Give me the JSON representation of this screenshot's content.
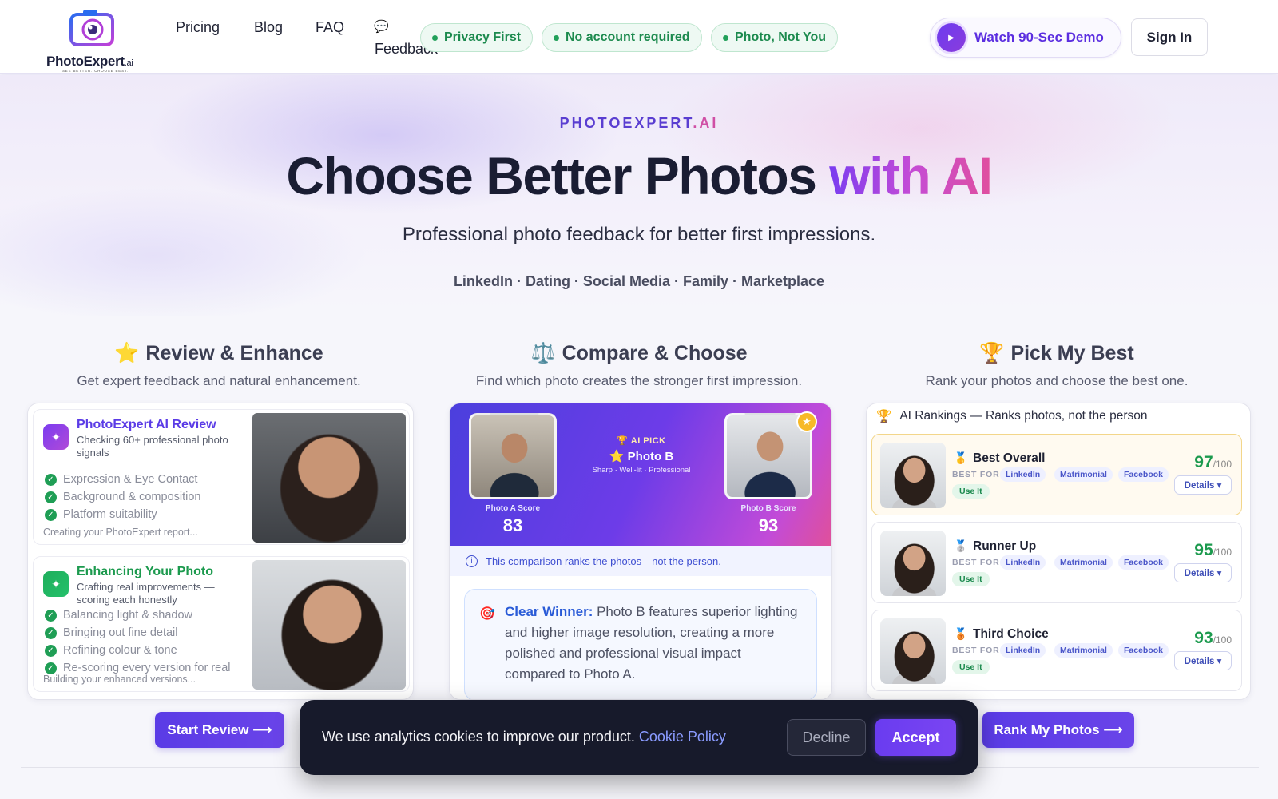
{
  "header": {
    "logo": {
      "brand": "PhotoExpert",
      "brand_suffix": ".ai",
      "tagline": "SEE BETTER. CHOOSE BEST."
    },
    "nav": [
      "Pricing",
      "Blog",
      "FAQ"
    ],
    "feedback_label": "Feedback",
    "pills": [
      "Privacy First",
      "No account required",
      "Photo, Not You"
    ],
    "demo_label": "Watch 90-Sec Demo",
    "signin_label": "Sign In"
  },
  "hero": {
    "eyebrow_main": "PHOTOEXPERT",
    "eyebrow_suffix": ".AI",
    "title_main": "Choose Better Photos ",
    "title_highlight": "with AI",
    "subtitle": "Professional photo feedback for better first impressions.",
    "categories": "LinkedIn · Dating · Social Media · Family · Marketplace"
  },
  "columns": [
    {
      "emoji": "⭐",
      "title": "Review & Enhance",
      "desc": "Get expert feedback and natural enhancement."
    },
    {
      "emoji": "⚖️",
      "title": "Compare & Choose",
      "desc": "Find which photo creates the stronger first impression."
    },
    {
      "emoji": "🏆",
      "title": "Pick My Best",
      "desc": "Rank your photos and choose the best one."
    }
  ],
  "review": {
    "card1": {
      "title": "PhotoExpert AI Review",
      "subtitle": "Checking 60+ professional photo signals",
      "items": [
        "Expression & Eye Contact",
        "Background & composition",
        "Platform suitability"
      ],
      "status": "Creating your PhotoExpert report..."
    },
    "card2": {
      "title": "Enhancing Your Photo",
      "subtitle": "Crafting real improvements — scoring each honestly",
      "items": [
        "Balancing light & shadow",
        "Bringing out fine detail",
        "Refining colour & tone",
        "Re-scoring every version for real"
      ],
      "status": "Building your enhanced versions..."
    }
  },
  "compare": {
    "photo_a_label": "Photo A Score",
    "photo_a_score": "83",
    "photo_b_label": "Photo B Score",
    "photo_b_score": "93",
    "ai_pick_label": "AI PICK",
    "ai_pick_winner": "Photo B",
    "ai_pick_traits": "Sharp · Well-lit · Professional",
    "note": "This comparison ranks the photos—not the person.",
    "winner_label": "Clear Winner:",
    "winner_text": " Photo B features superior lighting and higher image resolution, creating a more polished and professional visual impact compared to Photo A."
  },
  "rank": {
    "header": "AI Rankings — Ranks photos, not the person",
    "best_for_label": "BEST FOR",
    "use_it_label": "Use It",
    "details_label": "Details ▾",
    "score_suffix": "/100",
    "tags": [
      "LinkedIn",
      "Matrimonial",
      "Facebook"
    ],
    "items": [
      {
        "medal": "🥇",
        "title": "Best Overall",
        "score": "97"
      },
      {
        "medal": "🥈",
        "title": "Runner Up",
        "score": "95"
      },
      {
        "medal": "🥉",
        "title": "Third Choice",
        "score": "93"
      }
    ]
  },
  "ctas": {
    "review": "Start Review ⟶",
    "rank": "Rank My Photos ⟶"
  },
  "cookie": {
    "message": "We use analytics cookies to improve our product. ",
    "policy_link": "Cookie Policy",
    "decline": "Decline",
    "accept": "Accept"
  },
  "colors": {
    "accent": "#5a3be6",
    "success": "#1c8a4e",
    "banner": "#171a2b"
  }
}
